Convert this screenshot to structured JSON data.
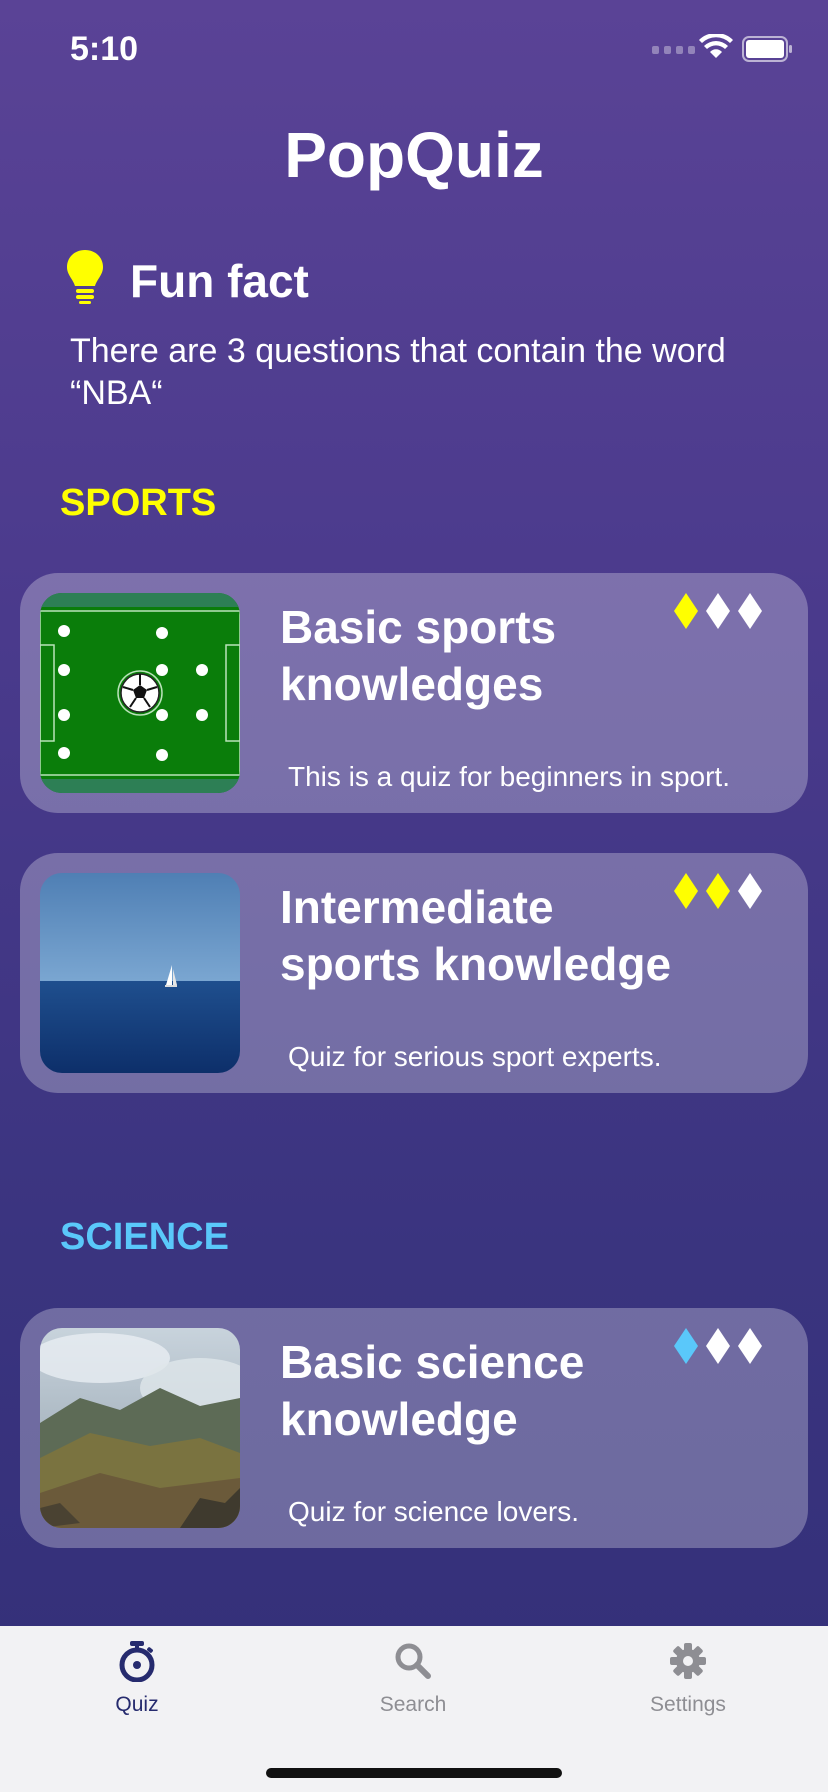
{
  "status": {
    "time": "5:10"
  },
  "app": {
    "title": "PopQuiz"
  },
  "funfact": {
    "title": "Fun fact",
    "text": "There are 3 questions that contain the word “NBA“"
  },
  "categories": [
    {
      "name": "SPORTS",
      "color": "#ffff00"
    },
    {
      "name": "SCIENCE",
      "color": "#5ac8fa"
    }
  ],
  "quizzes": [
    {
      "title": "Basic sports knowledges",
      "description": "This is a quiz for beginners in sport.",
      "difficulty": 1,
      "accent": "#ffff00",
      "image": "soccer-field-image"
    },
    {
      "title": "Intermediate sports knowledge",
      "description": "Quiz for serious sport experts.",
      "difficulty": 2,
      "accent": "#ffff00",
      "image": "sailboat-sea-image"
    },
    {
      "title": "Basic science knowledge",
      "description": "Quiz for science lovers.",
      "difficulty": 1,
      "accent": "#5ac8fa",
      "image": "mountain-landscape-image"
    }
  ],
  "tabs": [
    {
      "label": "Quiz",
      "icon": "stopwatch-icon",
      "active": true
    },
    {
      "label": "Search",
      "icon": "search-icon",
      "active": false
    },
    {
      "label": "Settings",
      "icon": "gear-icon",
      "active": false
    }
  ],
  "colors": {
    "active_tab": "#262b6e",
    "inactive_tab": "#8e8e93"
  }
}
